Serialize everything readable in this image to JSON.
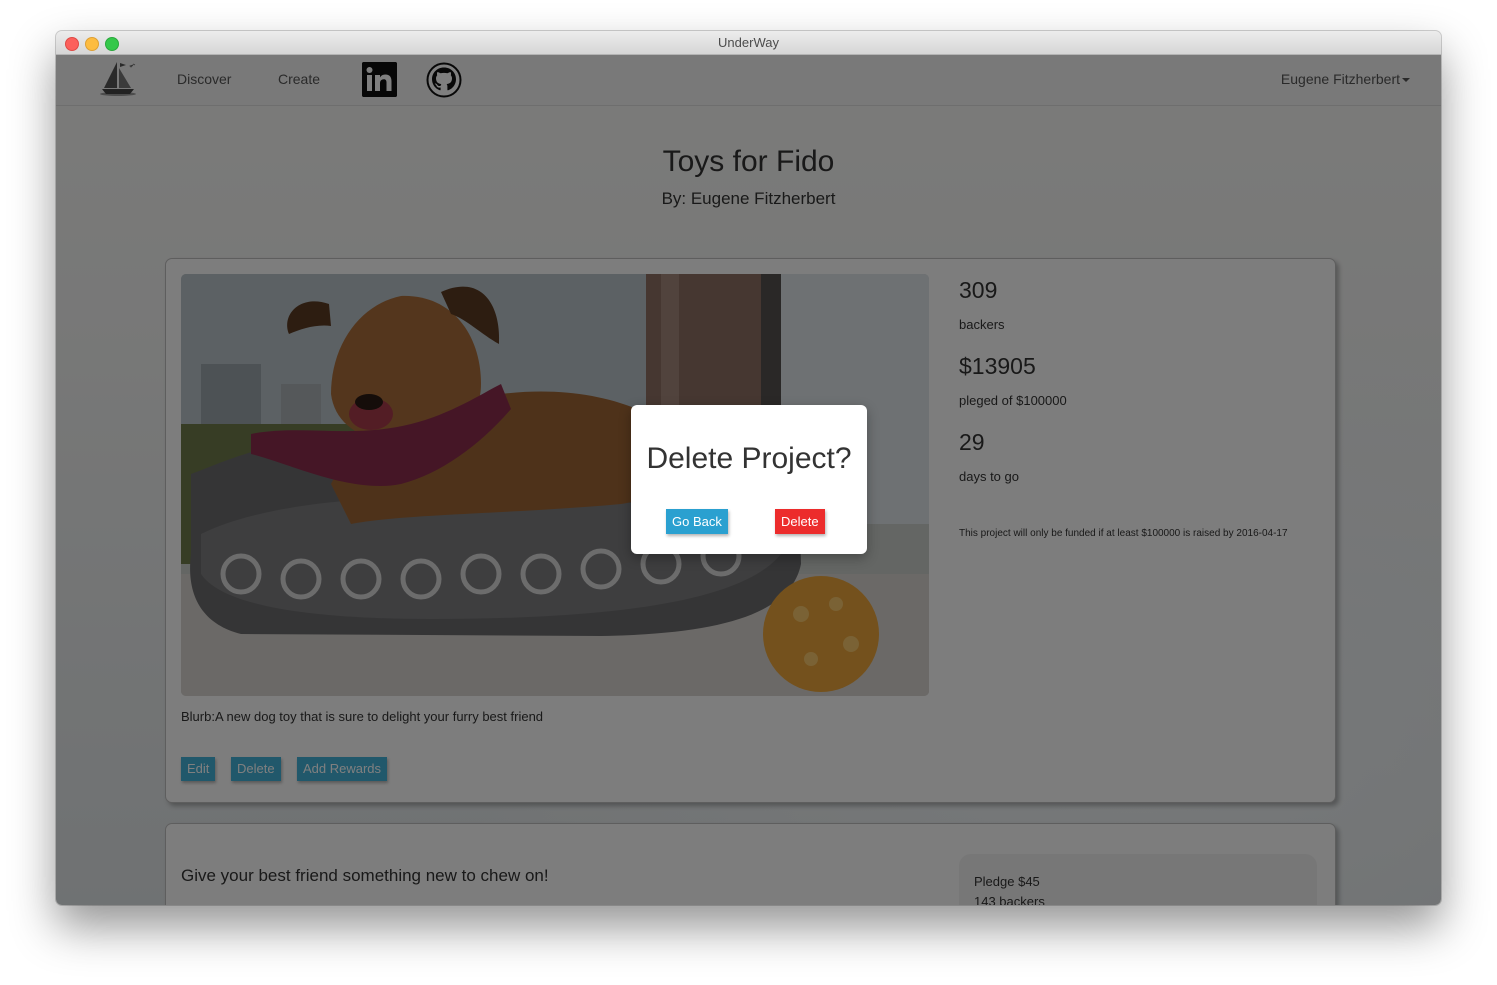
{
  "window": {
    "title": "UnderWay"
  },
  "nav": {
    "discover": "Discover",
    "create": "Create",
    "linkedin_icon": "linkedin-icon",
    "github_icon": "github-icon",
    "user": "Eugene Fitzherbert"
  },
  "project": {
    "title": "Toys for Fido",
    "author": "By: Eugene Fitzherbert",
    "blurb": "Blurb:A new dog toy that is sure to delight your furry best friend",
    "buttons": {
      "edit": "Edit",
      "delete": "Delete",
      "add_rewards": "Add Rewards"
    },
    "stats": {
      "backers": "309",
      "backers_label": "backers",
      "pledged": "$13905",
      "pledged_label": "pleged of $100000",
      "days": "29",
      "days_label": "days to go"
    },
    "funding_note": "This project will only be funded if at least $100000 is raised by 2016-04-17"
  },
  "reward": {
    "title": "Give your best friend something new to chew on!",
    "pledge": "Pledge $45",
    "backers": "143 backers"
  },
  "modal": {
    "title": "Delete Project?",
    "go_back": "Go Back",
    "delete": "Delete"
  },
  "colors": {
    "button_blue": "#42b0d7",
    "delete_red": "#ec2c2c"
  }
}
